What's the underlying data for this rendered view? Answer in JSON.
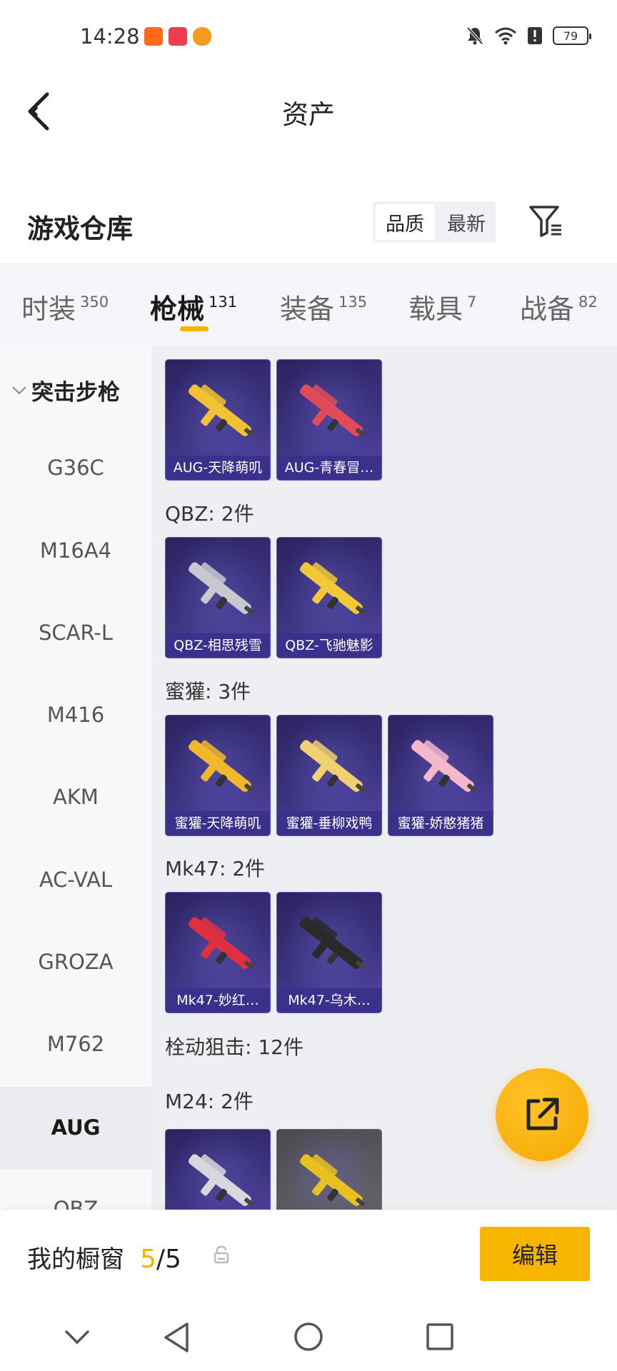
{
  "status_bar": {
    "time": "14:28",
    "battery": "79",
    "icons": [
      "taobao-app-icon",
      "cloud-app-icon",
      "fox-app-icon",
      "mute-icon",
      "wifi-icon",
      "alert-icon",
      "battery-icon"
    ]
  },
  "header": {
    "title": "资产",
    "back_icon": "back-arrow-icon"
  },
  "warehouse": {
    "title": "游戏仓库",
    "sort_options": [
      "品质",
      "最新"
    ],
    "sort_selected": "品质",
    "filter_icon": "filter-icon"
  },
  "tabs": [
    {
      "label": "时装",
      "count": "350"
    },
    {
      "label": "枪械",
      "count": "131",
      "active": true
    },
    {
      "label": "装备",
      "count": "135"
    },
    {
      "label": "载具",
      "count": "7"
    },
    {
      "label": "战备",
      "count": "82"
    }
  ],
  "sidebar": {
    "group": "突击步枪",
    "items": [
      "G36C",
      "M16A4",
      "SCAR-L",
      "M416",
      "AKM",
      "AC-VAL",
      "GROZA",
      "M762",
      "AUG",
      "QBZ"
    ],
    "selected": "AUG"
  },
  "content": {
    "sections": [
      {
        "label": "",
        "items": [
          "AUG-天降萌叽",
          "AUG-青春冒…"
        ]
      },
      {
        "label": "QBZ: 2件",
        "items": [
          "QBZ-相思残雪",
          "QBZ-飞驰魅影"
        ]
      },
      {
        "label": "蜜獾: 3件",
        "items": [
          "蜜獾-天降萌叽",
          "蜜獾-垂柳戏鸭",
          "蜜獾-娇憨猪猪"
        ]
      },
      {
        "label": "Mk47: 2件",
        "items": [
          "Mk47-妙红…",
          "Mk47-乌木…"
        ]
      },
      {
        "label": "栓动狙击: 12件",
        "items": []
      },
      {
        "label": "M24: 2件",
        "items": [
          "",
          ""
        ]
      }
    ],
    "weapon_colors": [
      "#f2c230",
      "#e04b5a",
      "#c8c8d0",
      "#f0c838",
      "#f0b82a",
      "#f0d070",
      "#f4b7cc",
      "#e03040",
      "#2a2a2a",
      "#d8d8dc",
      "#e8c020"
    ]
  },
  "fab": {
    "icon": "share-edit-icon"
  },
  "bottom_bar": {
    "label": "我的橱窗",
    "count_current": "5",
    "count_sep": "/",
    "count_total": "5",
    "lock_icon": "lock-icon",
    "edit_label": "编辑"
  },
  "nav_bar": {
    "icons": [
      "collapse-down-icon",
      "back-triangle-icon",
      "home-circle-icon",
      "recents-square-icon"
    ]
  }
}
